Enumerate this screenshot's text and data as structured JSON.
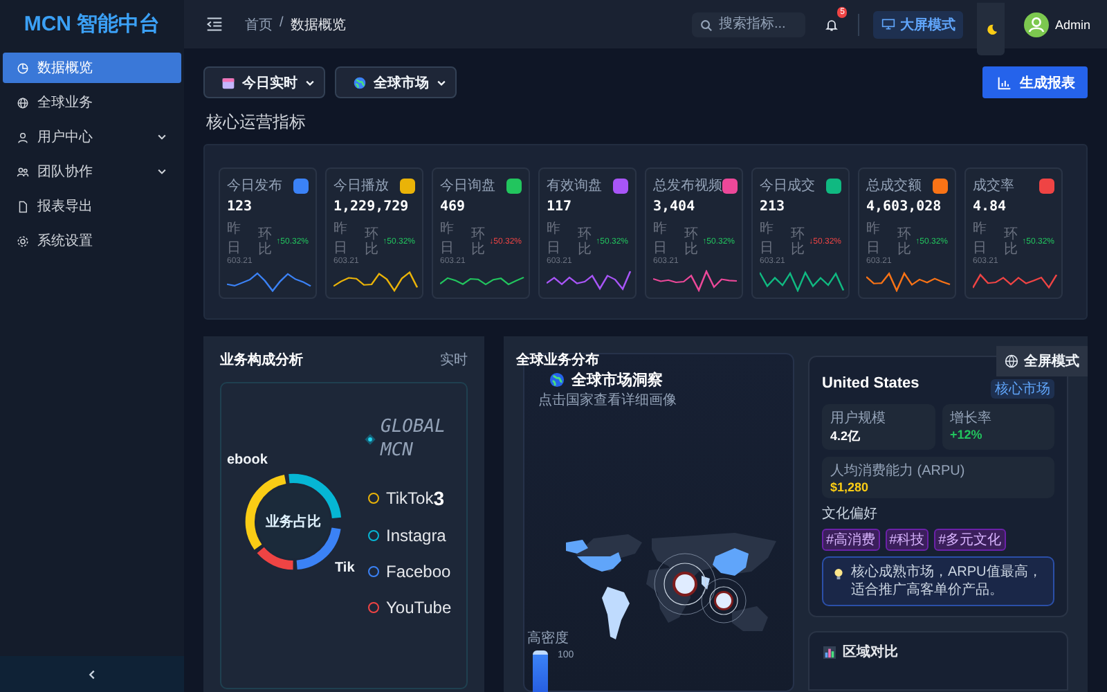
{
  "brand": "MCN 智能中台",
  "sidebar": {
    "items": [
      {
        "label": "数据概览",
        "selected": true,
        "expandable": false
      },
      {
        "label": "全球业务",
        "selected": false,
        "expandable": false
      },
      {
        "label": "用户中心",
        "selected": false,
        "expandable": true
      },
      {
        "label": "团队协作",
        "selected": false,
        "expandable": true
      },
      {
        "label": "报表导出",
        "selected": false,
        "expandable": false
      },
      {
        "label": "系统设置",
        "selected": false,
        "expandable": false
      }
    ]
  },
  "header": {
    "breadcrumb": [
      "首页",
      "数据概览"
    ],
    "separator": "/",
    "search": {
      "placeholder": "搜索指标..."
    },
    "notifications": "5",
    "screen_button": "大屏模式",
    "user": "Admin"
  },
  "toolbar": {
    "filters": [
      "今日实时",
      "全球市场"
    ],
    "report_button": "生成报表"
  },
  "section_title": "核心运营指标",
  "metrics": [
    {
      "label": "今日发布",
      "value": "123",
      "yesterday_label": "昨日",
      "yesterday": "603.21",
      "change_label": "环比",
      "change": "↑50.32%",
      "positive": true,
      "color": "#3b82f6"
    },
    {
      "label": "今日播放",
      "value": "1,229,729",
      "yesterday_label": "昨日",
      "yesterday": "603.21",
      "change_label": "环比",
      "change": "↑50.32%",
      "positive": true,
      "color": "#eab308"
    },
    {
      "label": "今日询盘",
      "value": "469",
      "yesterday_label": "昨日",
      "yesterday": "603.21",
      "change_label": "环比",
      "change": "↓50.32%",
      "positive": false,
      "color": "#22c55e"
    },
    {
      "label": "有效询盘",
      "value": "117",
      "yesterday_label": "昨日",
      "yesterday": "603.21",
      "change_label": "环比",
      "change": "↑50.32%",
      "positive": true,
      "color": "#a855f7"
    },
    {
      "label": "总发布视频",
      "value": "3,404",
      "yesterday_label": "昨日",
      "yesterday": "603.21",
      "change_label": "环比",
      "change": "↑50.32%",
      "positive": true,
      "color": "#ec4899"
    },
    {
      "label": "今日成交",
      "value": "213",
      "yesterday_label": "昨日",
      "yesterday": "603.21",
      "change_label": "环比",
      "change": "↓50.32%",
      "positive": false,
      "color": "#10b981"
    },
    {
      "label": "总成交额",
      "value": "4,603,028",
      "yesterday_label": "昨日",
      "yesterday": "603.21",
      "change_label": "环比",
      "change": "↑50.32%",
      "positive": true,
      "color": "#f97316"
    },
    {
      "label": "成交率",
      "value": "4.84",
      "yesterday_label": "昨日",
      "yesterday": "603.21",
      "change_label": "环比",
      "change": "↑50.32%",
      "positive": true,
      "color": "#ef4444"
    }
  ],
  "composition": {
    "title": "业务构成分析",
    "badge": "实时",
    "center": "业务占比",
    "callouts": [
      "ebook",
      "Tik"
    ],
    "brand_lines": [
      "GLOBAL",
      "MCN"
    ],
    "legend": [
      {
        "label": "TikTok",
        "value": "3",
        "color": "#eab308"
      },
      {
        "label": "Instagra",
        "color": "#06b6d4"
      },
      {
        "label": "Faceboo",
        "color": "#3b82f6"
      },
      {
        "label": "YouTube",
        "color": "#ef4444"
      }
    ]
  },
  "distribution": {
    "title": "全球业务分布",
    "fullscreen_button": "全屏模式",
    "map": {
      "title": "全球市场洞察",
      "subtitle": "点击国家查看详细画像",
      "legend_label": "高密度",
      "legend_max": "100"
    },
    "country": {
      "name": "United States",
      "tag": "核心市场",
      "stats": [
        {
          "label": "用户规模",
          "value": "4.2亿",
          "kind": "plain"
        },
        {
          "label": "增长率",
          "value": "+12%",
          "kind": "growth"
        },
        {
          "label": "人均消费能力 (ARPU)",
          "value": "$1,280",
          "kind": "money"
        }
      ],
      "preferences_label": "文化偏好",
      "preferences": [
        "#高消费",
        "#科技",
        "#多元文化"
      ],
      "insight": "核心成熟市场，ARPU值最高，适合推广高客单价产品。"
    },
    "compare_title": "区域对比"
  }
}
